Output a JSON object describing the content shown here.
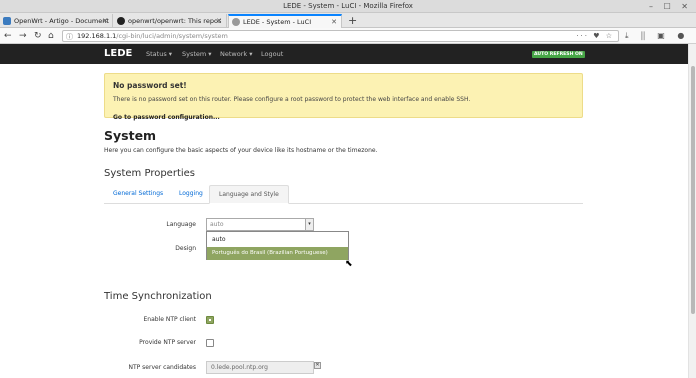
{
  "window": {
    "title": "LEDE - System - LuCI - Mozilla Firefox",
    "controls": "– ☐ ✕"
  },
  "tabs": [
    {
      "label": "OpenWrt - Artigo - Document"
    },
    {
      "label": "openwrt/openwrt: This repos"
    },
    {
      "label": "LEDE - System - LuCI"
    }
  ],
  "nav": {
    "url_host": "192.168.1.1",
    "url_path": "/cgi-bin/luci/admin/system/system",
    "url_icons": "··· ♥ ☆",
    "toolbar_icons": "⤓ ⫼ ▣ ● ☰"
  },
  "luci": {
    "brand": "LEDE",
    "menu": [
      "Status ▾",
      "System ▾",
      "Network ▾",
      "Logout"
    ],
    "auto_refresh": "AUTO REFRESH ON"
  },
  "alert": {
    "title": "No password set!",
    "text": "There is no password set on this router. Please configure a root password to protect the web interface and enable SSH.",
    "link": "Go to password configuration..."
  },
  "page": {
    "title": "System",
    "description": "Here you can configure the basic aspects of your device like its hostname or the timezone."
  },
  "system_properties": {
    "title": "System Properties",
    "tabs": [
      "General Settings",
      "Logging",
      "Language and Style"
    ],
    "language_label": "Language",
    "language_value": "auto",
    "design_label": "Design",
    "options": [
      "auto",
      "Português do Brasil (Brazilian Portuguese)"
    ]
  },
  "time_sync": {
    "title": "Time Synchronization",
    "enable_ntp_label": "Enable NTP client",
    "enable_ntp": true,
    "provide_ntp_label": "Provide NTP server",
    "provide_ntp": false,
    "candidates_label": "NTP server candidates",
    "candidate_1": "0.lede.pool.ntp.org"
  }
}
